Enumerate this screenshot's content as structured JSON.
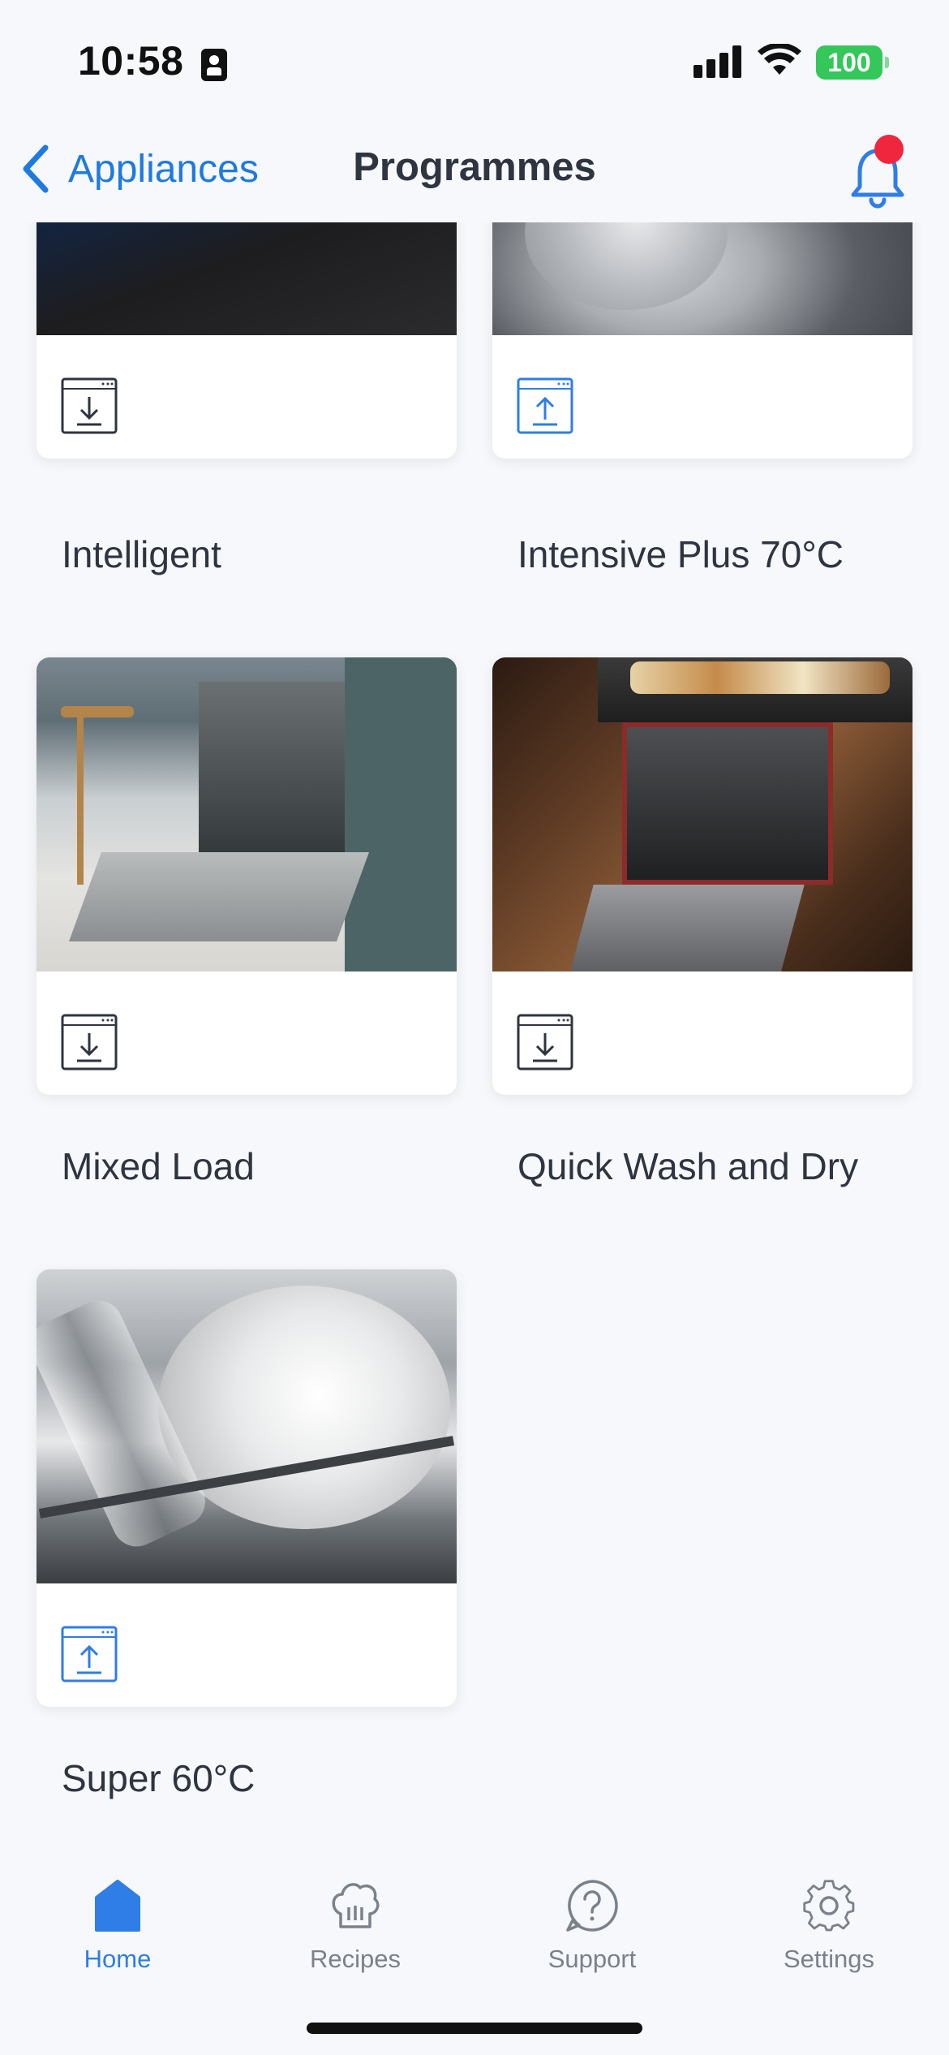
{
  "status_bar": {
    "time": "10:58",
    "battery": "100"
  },
  "nav": {
    "back_label": "Appliances",
    "title": "Programmes"
  },
  "programmes": [
    {
      "name": "Intelligent",
      "icon": "download-icon"
    },
    {
      "name": "Intensive Plus 70°C",
      "icon": "upload-icon"
    },
    {
      "name": "Mixed Load",
      "icon": "download-icon"
    },
    {
      "name": "Quick Wash and Dry",
      "icon": "download-icon"
    },
    {
      "name": "Super 60°C",
      "icon": "upload-icon"
    }
  ],
  "tabs": [
    {
      "label": "Home",
      "icon": "home-icon",
      "active": true
    },
    {
      "label": "Recipes",
      "icon": "chef-hat-icon",
      "active": false
    },
    {
      "label": "Support",
      "icon": "help-icon",
      "active": false
    },
    {
      "label": "Settings",
      "icon": "gear-icon",
      "active": false
    }
  ],
  "colors": {
    "accent": "#2f7de6",
    "notification": "#f0263f",
    "battery": "#34c759",
    "background": "#f6f8fb"
  }
}
